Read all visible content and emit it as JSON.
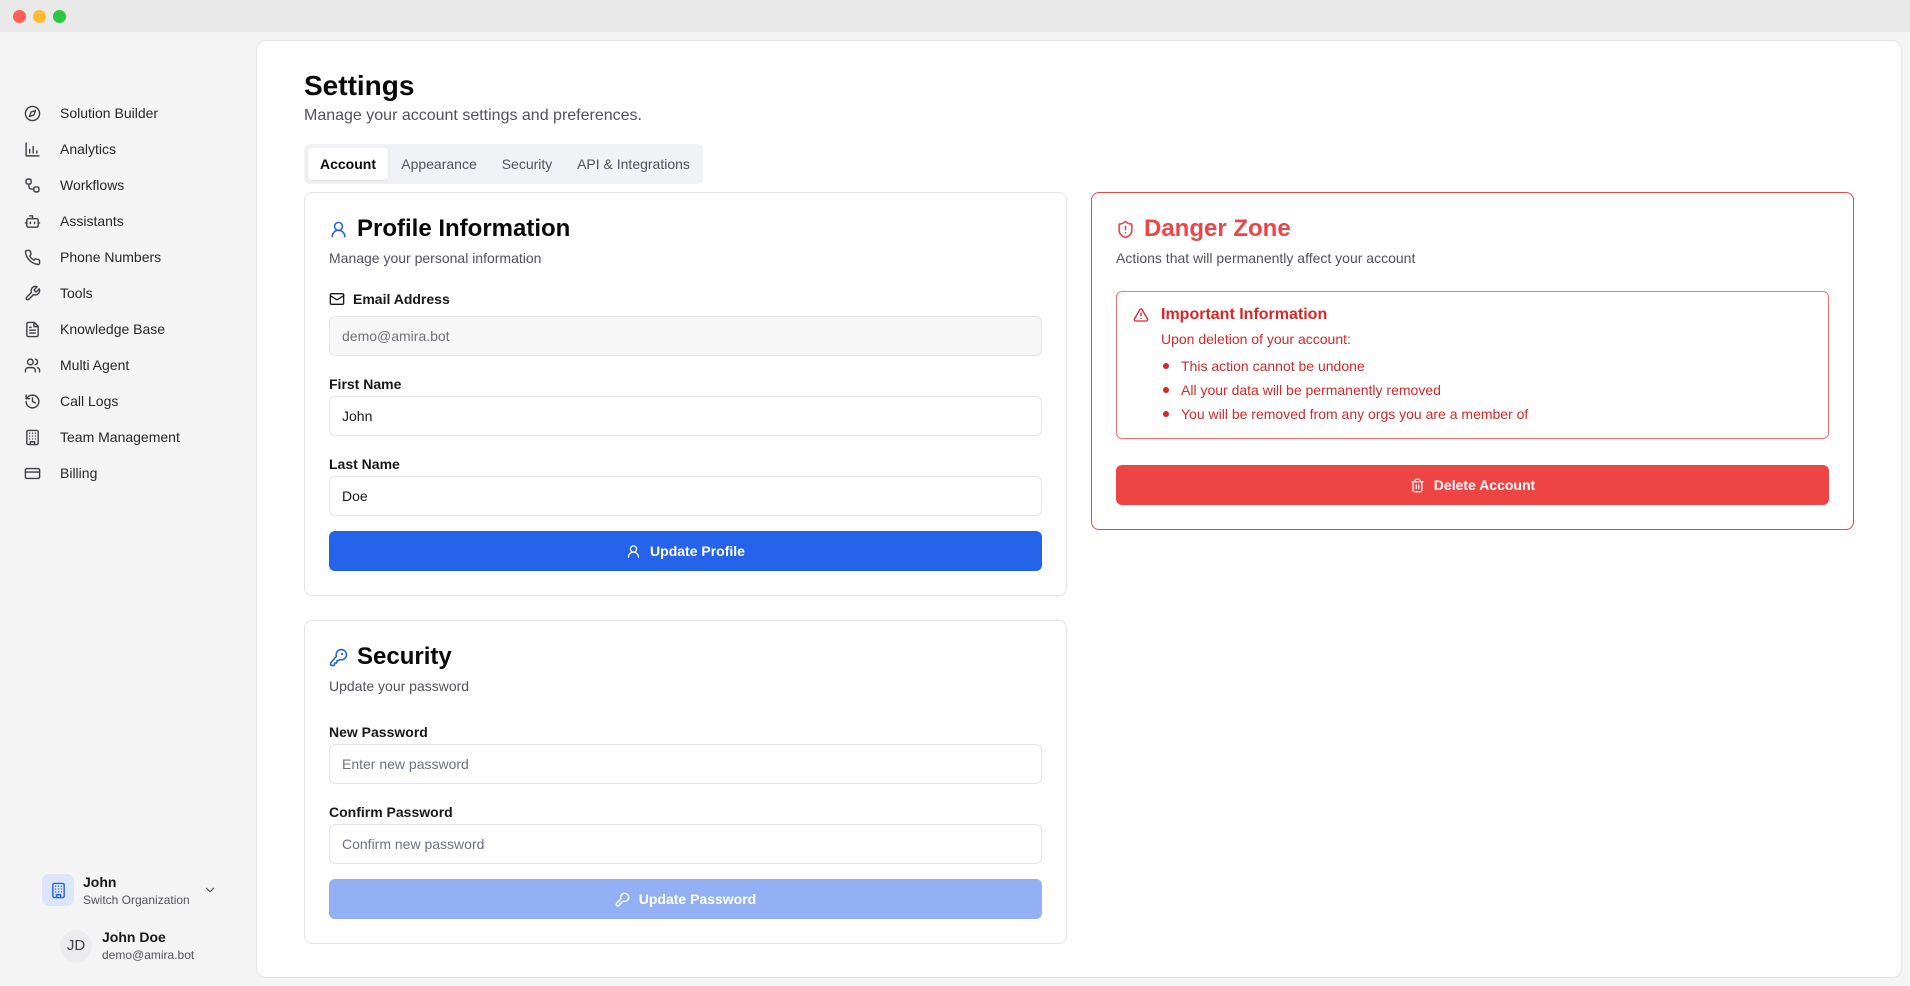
{
  "window": {
    "controls": [
      "close",
      "minimize",
      "maximize"
    ],
    "colors": {
      "close": "#ff5f57",
      "minimize": "#febc2e",
      "maximize": "#28c840"
    }
  },
  "sidebar": {
    "items": [
      {
        "label": "Solution Builder",
        "icon": "compass-icon"
      },
      {
        "label": "Analytics",
        "icon": "bar-chart-icon"
      },
      {
        "label": "Workflows",
        "icon": "workflow-icon"
      },
      {
        "label": "Assistants",
        "icon": "bot-icon"
      },
      {
        "label": "Phone Numbers",
        "icon": "phone-icon"
      },
      {
        "label": "Tools",
        "icon": "wrench-icon"
      },
      {
        "label": "Knowledge Base",
        "icon": "file-text-icon"
      },
      {
        "label": "Multi Agent",
        "icon": "users-icon"
      },
      {
        "label": "Call Logs",
        "icon": "history-icon"
      },
      {
        "label": "Team Management",
        "icon": "building-icon"
      },
      {
        "label": "Billing",
        "icon": "credit-card-icon"
      }
    ],
    "org": {
      "name": "John",
      "subtitle": "Switch Organization"
    },
    "user": {
      "initials": "JD",
      "name": "John Doe",
      "email": "demo@amira.bot"
    }
  },
  "header": {
    "title": "Settings",
    "subtitle": "Manage your account settings and preferences."
  },
  "tabs": [
    {
      "label": "Account",
      "active": true
    },
    {
      "label": "Appearance",
      "active": false
    },
    {
      "label": "Security",
      "active": false
    },
    {
      "label": "API & Integrations",
      "active": false
    }
  ],
  "profile": {
    "title": "Profile Information",
    "subtitle": "Manage your personal information",
    "email_label": "Email Address",
    "email_value": "demo@amira.bot",
    "first_name_label": "First Name",
    "first_name_value": "John",
    "last_name_label": "Last Name",
    "last_name_value": "Doe",
    "button": "Update Profile"
  },
  "security": {
    "title": "Security",
    "subtitle": "Update your password",
    "new_password_label": "New Password",
    "new_password_placeholder": "Enter new password",
    "confirm_password_label": "Confirm Password",
    "confirm_password_placeholder": "Confirm new password",
    "button": "Update Password"
  },
  "danger": {
    "title": "Danger Zone",
    "subtitle": "Actions that will permanently affect your account",
    "info_title": "Important Information",
    "info_sub": "Upon deletion of your account:",
    "items": [
      "This action cannot be undone",
      "All your data will be permanently removed",
      "You will be removed from any orgs you are a member of"
    ],
    "button": "Delete Account"
  },
  "colors": {
    "primary": "#2563eb",
    "primary_disabled": "#93b0f4",
    "danger": "#ef4444",
    "danger_text": "#dc2626"
  }
}
